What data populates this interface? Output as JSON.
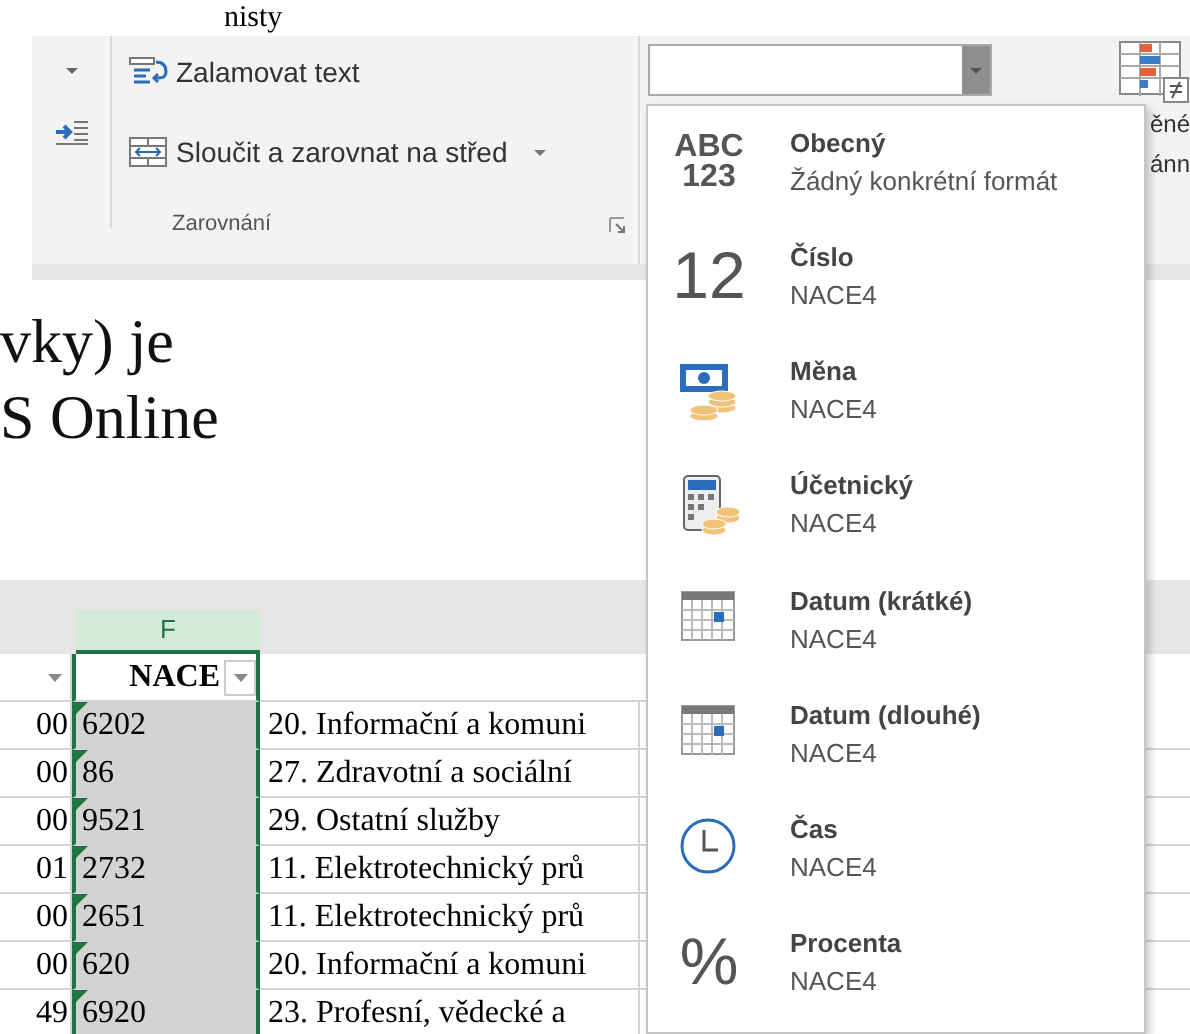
{
  "top_text": "nisty",
  "ribbon": {
    "alignment_group": {
      "label": "Zarovnání",
      "buttons": [
        {
          "label": "Zalamovat text",
          "kind": "wrap",
          "dropdown": false
        },
        {
          "label": "Sloučit a zarovnat na střed",
          "kind": "merge",
          "dropdown": true
        }
      ]
    },
    "cut_labels": [
      "ěné",
      "ánn"
    ]
  },
  "document_text": [
    "vky) je",
    "S Online"
  ],
  "sheet": {
    "selected_column": "F",
    "header_cell": "NACE",
    "rows": [
      {
        "col_1": "00",
        "nace": "6202",
        "col_3": "20. Informační a komuni"
      },
      {
        "col_1": "00",
        "nace": "86",
        "col_3": "27. Zdravotní a sociální"
      },
      {
        "col_1": "00",
        "nace": "9521",
        "col_3": "29. Ostatní služby"
      },
      {
        "col_1": "01",
        "nace": "2732",
        "col_3": "11. Elektrotechnický prů"
      },
      {
        "col_1": "00",
        "nace": "2651",
        "col_3": "11. Elektrotechnický prů"
      },
      {
        "col_1": "00",
        "nace": "620",
        "col_3": "20. Informační a komuni"
      },
      {
        "col_1": "49",
        "nace": "6920",
        "col_3": "23. Profesní, vědecké a"
      }
    ]
  },
  "format_menu": {
    "items": [
      {
        "kind": "general",
        "icon_text": [
          "ABC",
          "123"
        ],
        "title": "Obecný",
        "sample": "Žádný konkrétní formát"
      },
      {
        "kind": "number",
        "icon_text": [
          "12"
        ],
        "title": "Číslo",
        "sample": "NACE4"
      },
      {
        "kind": "currency",
        "title": "Měna",
        "sample": "NACE4"
      },
      {
        "kind": "accounting",
        "title": "Účetnický",
        "sample": "NACE4"
      },
      {
        "kind": "short-date",
        "title": "Datum (krátké)",
        "sample": "NACE4"
      },
      {
        "kind": "long-date",
        "title": "Datum (dlouhé)",
        "sample": "NACE4"
      },
      {
        "kind": "time",
        "title": "Čas",
        "sample": "NACE4"
      },
      {
        "kind": "percent",
        "icon_text": [
          "%"
        ],
        "title": "Procenta",
        "sample": "NACE4"
      }
    ]
  }
}
